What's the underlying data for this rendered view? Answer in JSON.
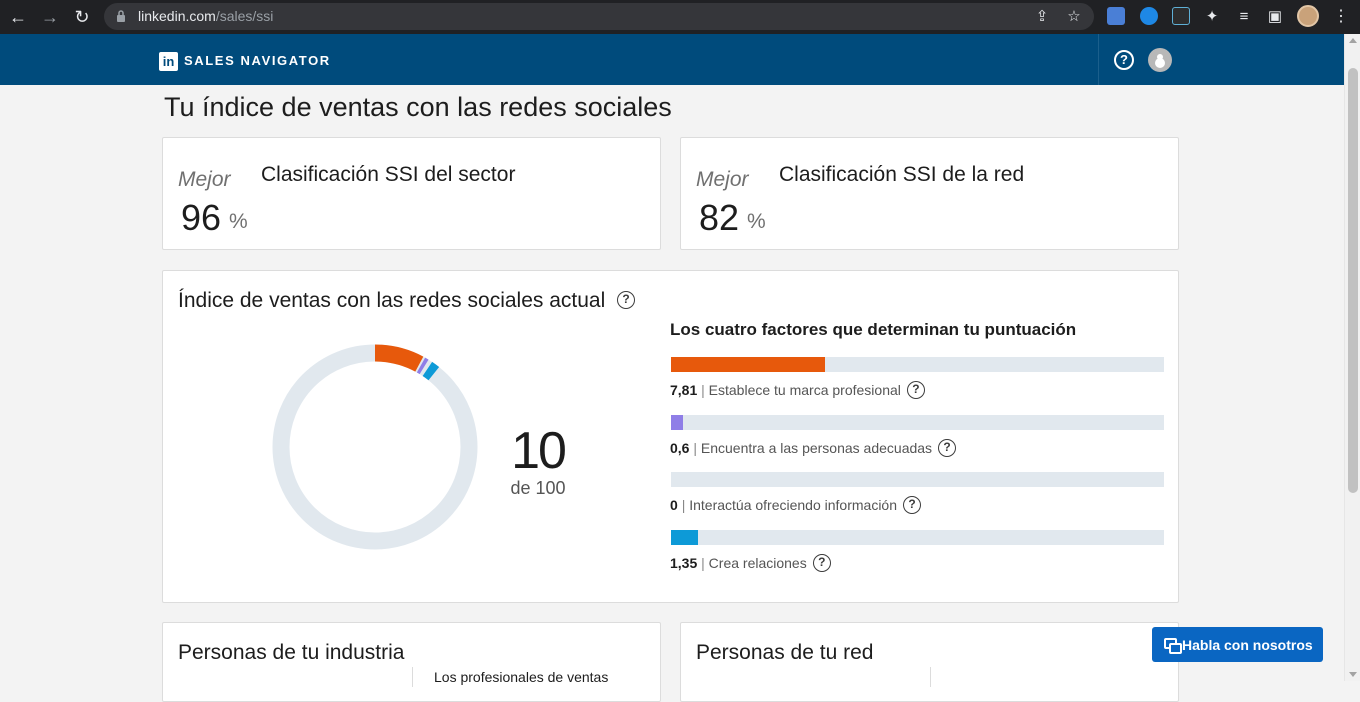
{
  "browser": {
    "url_host": "linkedin.com",
    "url_path": "/sales/ssi"
  },
  "header": {
    "logo_text": "in",
    "brand": "SALES NAVIGATOR",
    "help_icon_glyph": "?"
  },
  "page": {
    "title": "Tu índice de ventas con las redes sociales"
  },
  "rankings": [
    {
      "best": "Mejor",
      "value": "96",
      "unit": "%",
      "label": "Clasificación SSI del sector"
    },
    {
      "best": "Mejor",
      "value": "82",
      "unit": "%",
      "label": "Clasificación SSI de la red"
    }
  ],
  "ssi": {
    "title": "Índice de ventas con las redes sociales actual",
    "score": "10",
    "score_of": "de 100",
    "factors_title": "Los cuatro factores que determinan tu puntuación",
    "factors": [
      {
        "value": "7,81",
        "label": "Establece tu marca profesional",
        "fraction": 0.3124,
        "color": "#e7590c"
      },
      {
        "value": "0,6",
        "label": "Encuentra a las personas adecuadas",
        "fraction": 0.024,
        "color": "#8f7ee7"
      },
      {
        "value": "0",
        "label": "Interactúa ofreciendo información",
        "fraction": 0,
        "color": "#2eaa7e"
      },
      {
        "value": "1,35",
        "label": "Crea relaciones",
        "fraction": 0.054,
        "color": "#0d9ad7"
      }
    ],
    "separator": "|",
    "question_glyph": "?",
    "track_color": "#e1e8ee"
  },
  "bottom_cards": [
    {
      "title": "Personas de tu industria",
      "snippet": "Los profesionales de ventas"
    },
    {
      "title": "Personas de tu red",
      "snippet": ""
    }
  ],
  "chat": {
    "label": "Habla con nosotros"
  },
  "colors": {
    "header_bg": "#004b7c",
    "chat_bg": "#0a66c2"
  }
}
